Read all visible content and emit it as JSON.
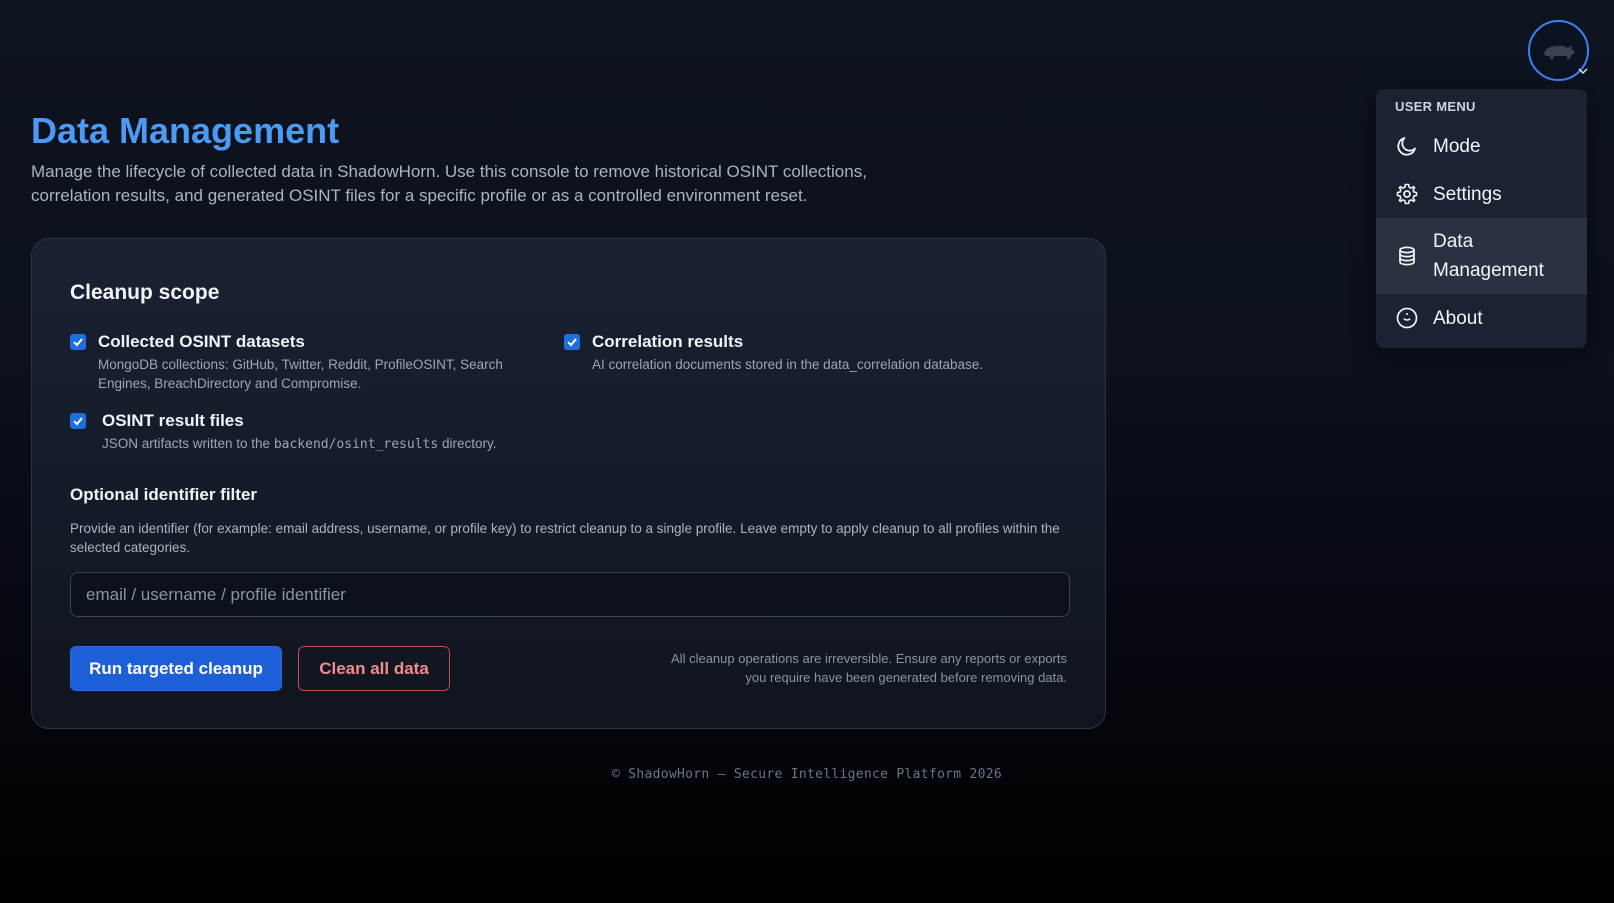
{
  "header": {
    "avatar_icon": "rhino-avatar-icon"
  },
  "user_menu": {
    "title": "USER MENU",
    "items": [
      {
        "label": "Mode",
        "icon": "moon-icon",
        "active": false
      },
      {
        "label": "Settings",
        "icon": "gear-icon",
        "active": false
      },
      {
        "label": "Data Management",
        "icon": "database-icon",
        "active": true
      },
      {
        "label": "About",
        "icon": "smile-circle-icon",
        "active": false
      }
    ]
  },
  "page": {
    "title": "Data Management",
    "description": "Manage the lifecycle of collected data in ShadowHorn. Use this console to remove historical OSINT collections, correlation results, and generated OSINT files for a specific profile or as a controlled environment reset."
  },
  "cleanup": {
    "title": "Cleanup scope",
    "options": [
      {
        "label": "Collected OSINT datasets",
        "description": "MongoDB collections: GitHub, Twitter, Reddit, ProfileOSINT, Search Engines, BreachDirectory and Compromise.",
        "checked": true
      },
      {
        "label": "Correlation results",
        "description": "AI correlation documents stored in the data_correlation database.",
        "checked": true
      },
      {
        "label": "OSINT result files",
        "description_before": "JSON artifacts written to the ",
        "description_code": "backend/osint_results",
        "description_after": " directory.",
        "checked": true
      }
    ]
  },
  "filter": {
    "title": "Optional identifier filter",
    "description": "Provide an identifier (for example: email address, username, or profile key) to restrict cleanup to a single profile. Leave empty to apply cleanup to all profiles within the selected categories.",
    "placeholder": "email / username / profile identifier",
    "value": ""
  },
  "actions": {
    "primary_label": "Run targeted cleanup",
    "danger_label": "Clean all data",
    "warning": "All cleanup operations are irreversible. Ensure any reports or exports you require have been generated before removing data."
  },
  "footer": {
    "text": "© ShadowHorn — Secure Intelligence Platform 2026"
  },
  "colors": {
    "accent": "#4b9bf5",
    "primary_button": "#1d5fd6",
    "danger": "#c94a4a",
    "checkbox": "#1d6fe0"
  }
}
